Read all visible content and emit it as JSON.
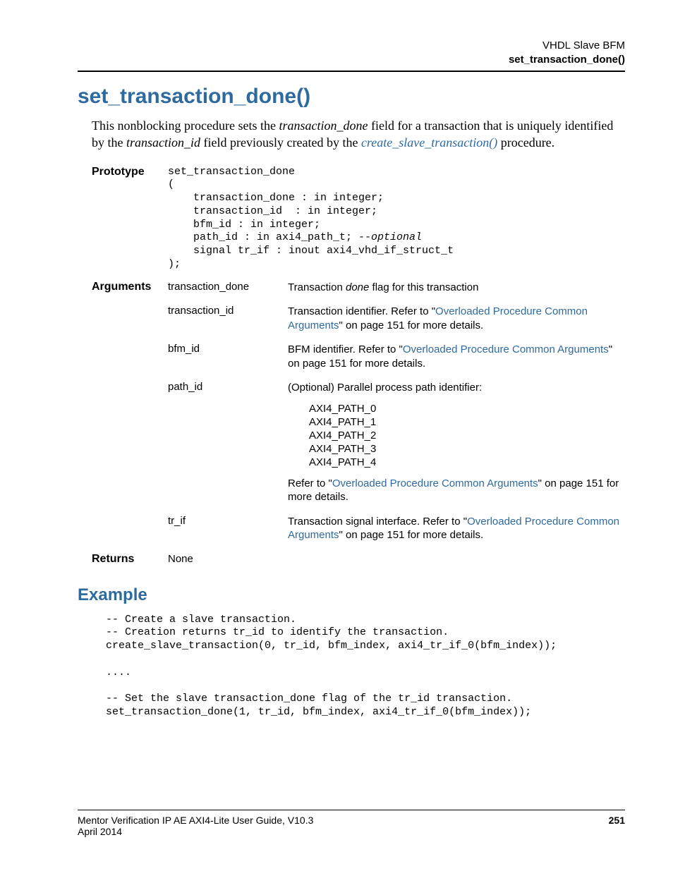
{
  "header": {
    "line1": "VHDL Slave BFM",
    "line2": "set_transaction_done()"
  },
  "title": "set_transaction_done()",
  "intro": {
    "p1a": "This nonblocking procedure sets the ",
    "p1b": "transaction_done",
    "p1c": " field for a transaction that is uniquely identified by the ",
    "p1d": "transaction_id",
    "p1e": " field previously created by the ",
    "p1link": "create_slave_transaction()",
    "p1f": " procedure."
  },
  "proto": {
    "label": "Prototype",
    "line1": "set_transaction_done",
    "line2": "(",
    "line3": "    transaction_done : in integer;",
    "line4": "    transaction_id  : in integer;",
    "line5": "    bfm_id : in integer;",
    "line6a": "    path_id : in axi4_path_t; ",
    "line6b": "--optional",
    "line7": "    signal tr_if : inout axi4_vhd_if_struct_t",
    "line8": ");"
  },
  "args": {
    "label": "Arguments",
    "rows": [
      {
        "name": "transaction_done",
        "desc_a": "Transaction ",
        "desc_i": "done",
        "desc_b": " flag for this transaction"
      },
      {
        "name": "transaction_id",
        "desc_a": "Transaction identifier. Refer to \"",
        "link": "Overloaded Procedure Common Arguments",
        "desc_b": "\" on page 151 for more details."
      },
      {
        "name": "bfm_id",
        "desc_a": "BFM identifier. Refer to \"",
        "link": "Overloaded Procedure Common Arguments",
        "desc_b": "\" on page 151 for more details."
      },
      {
        "name": "path_id",
        "desc_intro": "(Optional) Parallel process path identifier:",
        "enum": [
          "AXI4_PATH_0",
          "AXI4_PATH_1",
          "AXI4_PATH_2",
          "AXI4_PATH_3",
          "AXI4_PATH_4"
        ],
        "desc_ref_a": "Refer to \"",
        "link": "Overloaded Procedure Common Arguments",
        "desc_ref_b": "\" on page 151 for more details."
      },
      {
        "name": "tr_if",
        "desc_a": "Transaction signal interface. Refer to \"",
        "link": "Overloaded Procedure Common Arguments",
        "desc_b": "\" on page 151 for more details."
      }
    ]
  },
  "returns": {
    "label": "Returns",
    "value": "None"
  },
  "example": {
    "heading": "Example",
    "l1": "-- Create a slave transaction.",
    "l2": "-- Creation returns tr_id to identify the transaction.",
    "l3": "create_slave_transaction(0, tr_id, bfm_index, axi4_tr_if_0(bfm_index));",
    "l4": "",
    "l5": "....",
    "l6": "",
    "l7": "-- Set the slave transaction_done flag of the tr_id transaction.",
    "l8": "set_transaction_done(1, tr_id, bfm_index, axi4_tr_if_0(bfm_index));"
  },
  "footer": {
    "left1": "Mentor Verification IP AE AXI4-Lite User Guide, V10.3",
    "left2": "April 2014",
    "page": "251"
  }
}
